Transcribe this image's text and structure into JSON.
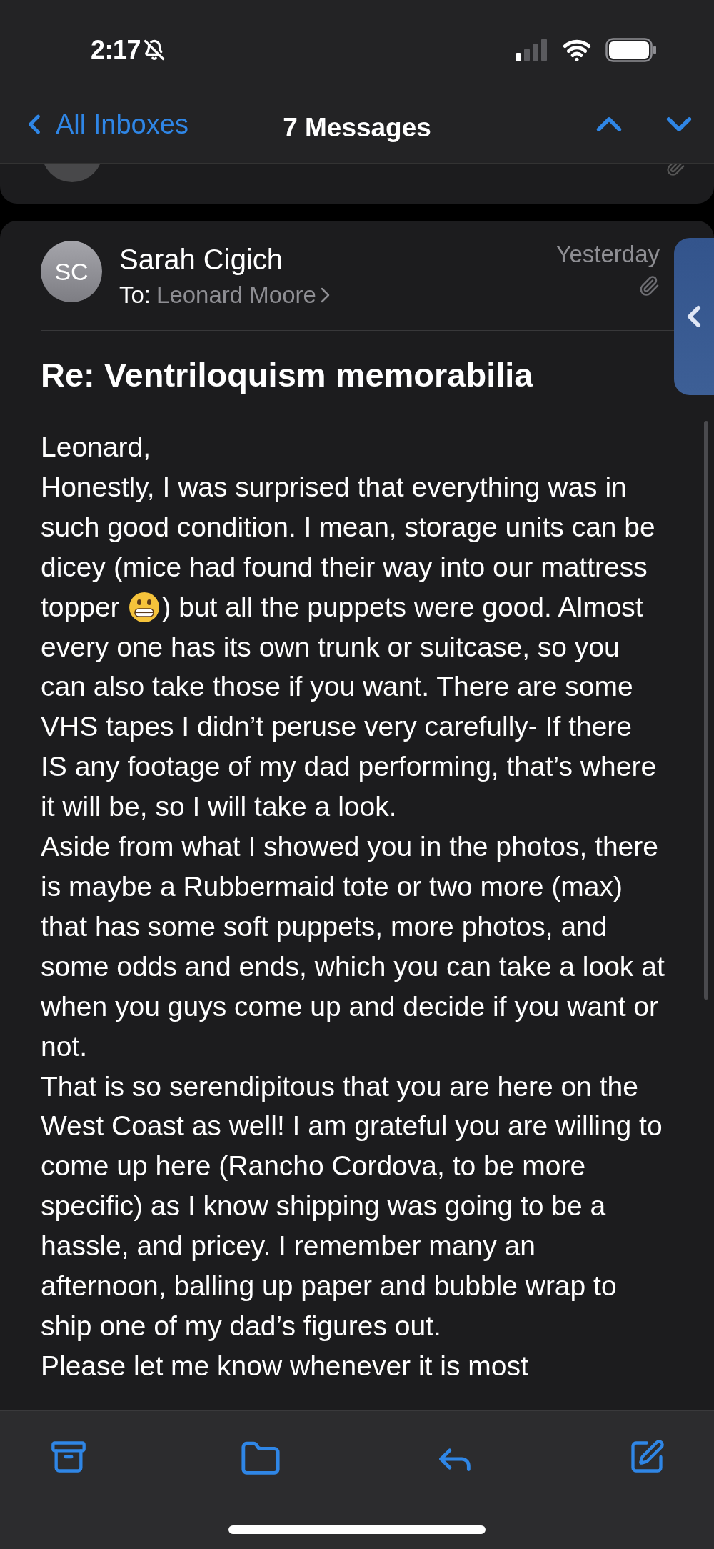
{
  "status_bar": {
    "time": "2:17"
  },
  "nav": {
    "back_label": "All Inboxes",
    "title": "7 Messages"
  },
  "message": {
    "avatar_initials": "SC",
    "sender": "Sarah Cigich",
    "to_label": "To:",
    "recipient": "Leonard Moore",
    "date": "Yesterday",
    "subject": "Re: Ventriloquism memorabilia",
    "body_lines": [
      {
        "kind": "text",
        "text": "Leonard,"
      },
      {
        "kind": "text",
        "text": "Honestly, I was surprised that everything was in"
      },
      {
        "kind": "text",
        "text": "such good condition. I mean, storage units can be"
      },
      {
        "kind": "text",
        "text": "dicey (mice had found their way into our mattress"
      },
      {
        "kind": "emoji",
        "before": "topper",
        "after": ") but all the puppets were good. Almost"
      },
      {
        "kind": "text",
        "text": "every one has its own trunk or suitcase, so you"
      },
      {
        "kind": "text",
        "text": "can also take those if you want. There are some"
      },
      {
        "kind": "text",
        "text": "VHS tapes I didn’t peruse very carefully- If there"
      },
      {
        "kind": "text",
        "text": "IS any footage of my dad performing, that’s where"
      },
      {
        "kind": "text",
        "text": "it will be, so I will take a look."
      },
      {
        "kind": "text",
        "text": "Aside from what I showed you in the photos, there"
      },
      {
        "kind": "text",
        "text": "is maybe a Rubbermaid tote or two more (max)"
      },
      {
        "kind": "text",
        "text": "that has some soft puppets, more photos, and"
      },
      {
        "kind": "text",
        "text": "some odds and ends, which you can take a look at"
      },
      {
        "kind": "text",
        "text": "when you guys come up and decide if you want or"
      },
      {
        "kind": "text",
        "text": "not."
      },
      {
        "kind": "text",
        "text": "That is so serendipitous that you are here on the"
      },
      {
        "kind": "text",
        "text": "West Coast as well! I am grateful you are willing to"
      },
      {
        "kind": "text",
        "text": "come up here (Rancho Cordova, to be more"
      },
      {
        "kind": "text",
        "text": "specific) as I know shipping was going to be a"
      },
      {
        "kind": "text",
        "text": "hassle, and pricey. I remember many an"
      },
      {
        "kind": "text",
        "text": "afternoon, balling up paper and bubble wrap to"
      },
      {
        "kind": "text",
        "text": "ship one of my dad’s figures out."
      },
      {
        "kind": "text",
        "text": "Please let me know whenever it is most"
      }
    ]
  }
}
